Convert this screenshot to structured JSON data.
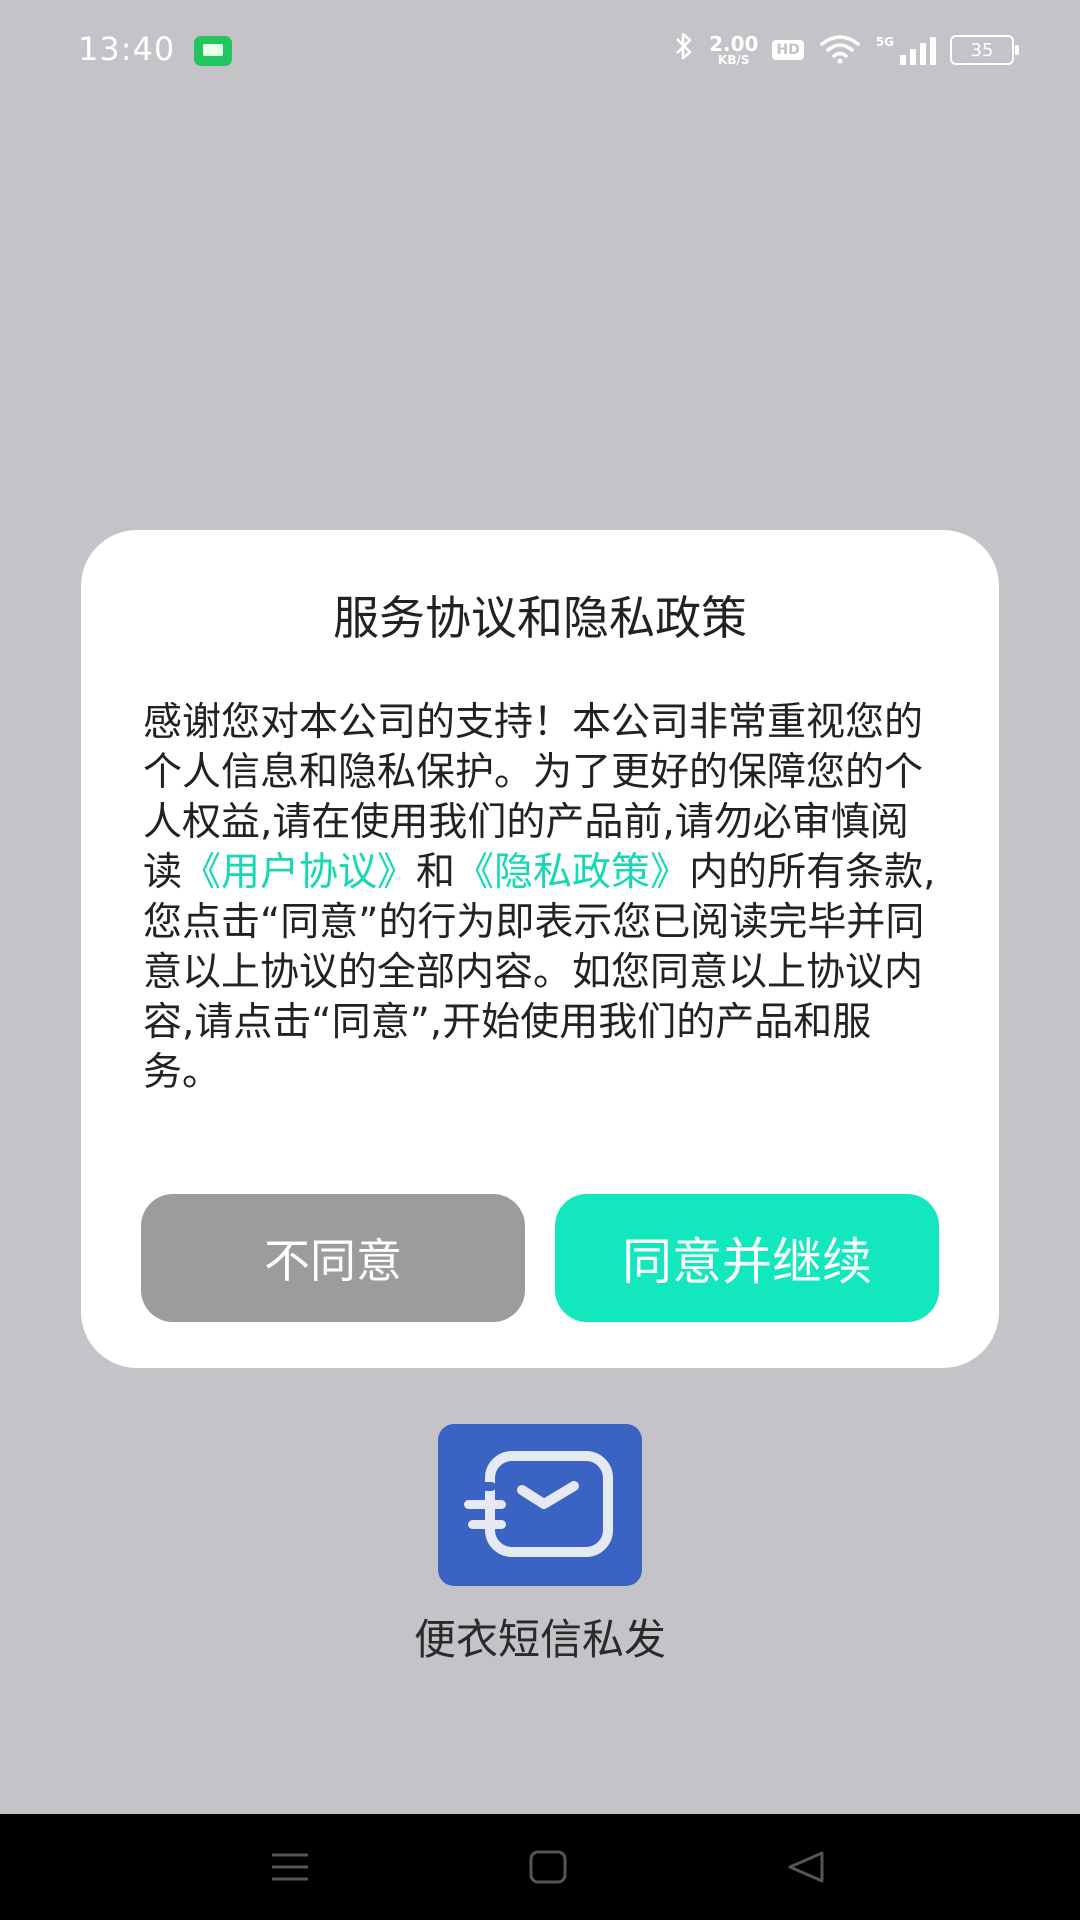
{
  "status_bar": {
    "time": "13:40",
    "net_speed_value": "2.00",
    "net_speed_unit": "KB/S",
    "hd_label": "HD",
    "network_label": "5G",
    "battery": "35"
  },
  "dialog": {
    "title": "服务协议和隐私政策",
    "body_part1": "感谢您对本公司的支持！本公司非常重视您的个人信息和隐私保护。为了更好的保障您的个人权益,请在使用我们的产品前,请勿必审慎阅读",
    "link_user_agreement": "《用户协议》",
    "body_part2": "和",
    "link_privacy_policy": "《隐私政策》",
    "body_part3": "内的所有条款,您点击“同意”的行为即表示您已阅读完毕并同意以上协议的全部内容。如您同意以上协议内容,请点击“同意”,开始使用我们的产品和服务。",
    "disagree_label": "不同意",
    "agree_label": "同意并继续",
    "colors": {
      "link": "#17d8b4",
      "agree_button": "#12e7bd",
      "disagree_button": "#9c9c9c"
    }
  },
  "app": {
    "name": "便衣短信私发",
    "icon": "message-envelope-icon",
    "icon_color": "#3b63c4"
  },
  "nav_bar": {
    "icons": [
      "menu-icon",
      "home-square-icon",
      "back-triangle-icon"
    ]
  }
}
